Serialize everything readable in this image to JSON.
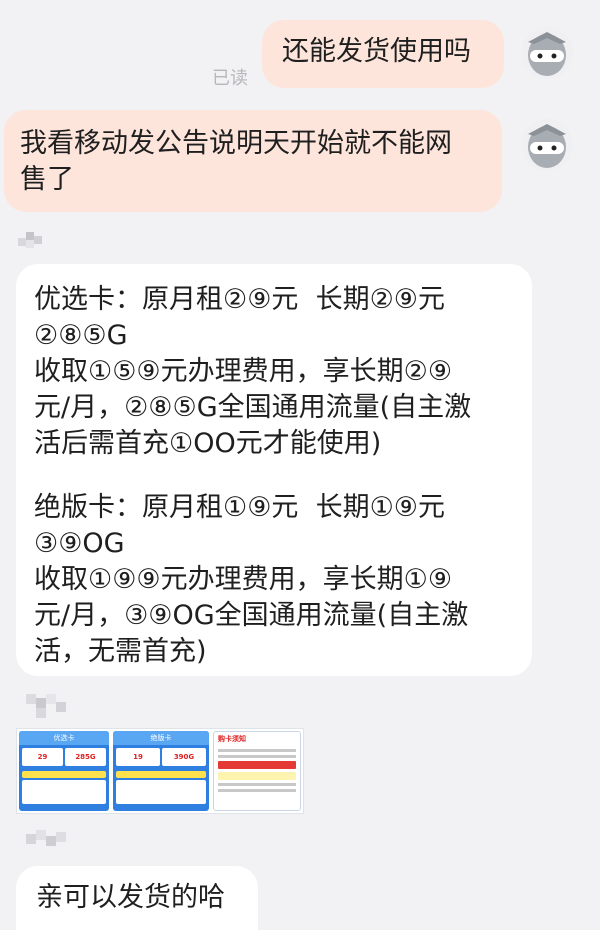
{
  "messages": {
    "outgoing": {
      "text": "还能发货使用吗",
      "read_status": "已读"
    },
    "incoming_1": {
      "line1": "我看移动发公告说明天开始就不能网",
      "line2": "售了"
    },
    "incoming_card": {
      "lines": [
        "优选卡：原月租②⑨元  长期②⑨元",
        "②⑧⑤G",
        "收取①⑤⑨元办理费用，享长期②⑨",
        "元/月，②⑧⑤G全国通用流量(自主激",
        "活后需首充①OO元才能使用)",
        "",
        "绝版卡：原月租①⑨元  长期①⑨元",
        "③⑨OG",
        "收取①⑨⑨元办理费用，享长期①⑨",
        "元/月，③⑨OG全国通用流量(自主激",
        "活，无需首充)"
      ]
    },
    "image_thumb": {
      "panel1_title": "优选卡",
      "panel1_price": "29",
      "panel1_data": "285G",
      "panel2_title": "绝版卡",
      "panel2_price": "19",
      "panel2_data": "390G",
      "notice_title": "购卡须知"
    },
    "incoming_last": {
      "text": "亲可以发货的哈"
    }
  },
  "colors": {
    "outgoing_bubble": "#fde5dc",
    "incoming_bubble": "#ffffff",
    "background": "#f2f2f4"
  }
}
